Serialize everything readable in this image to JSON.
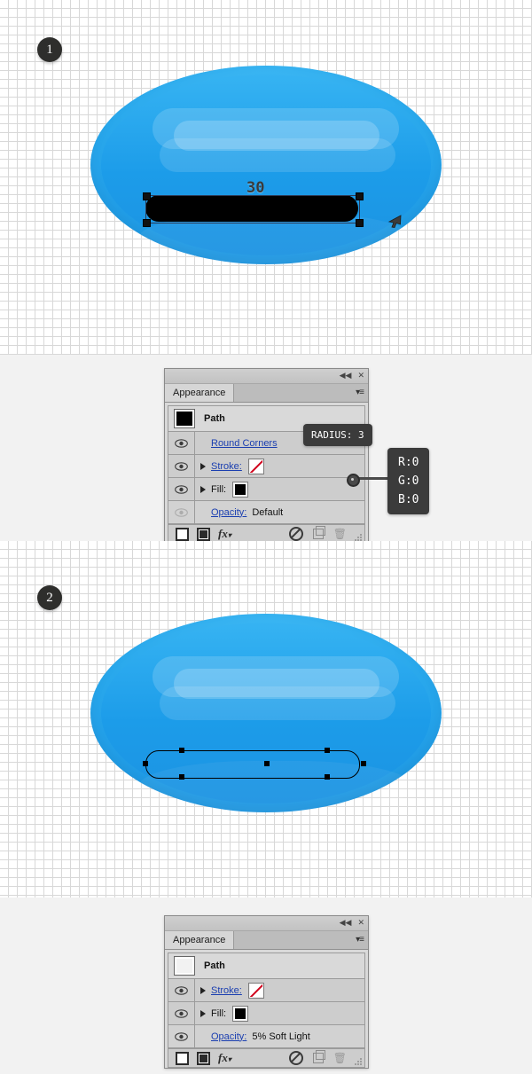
{
  "illustrations": [
    {
      "step_number": "1",
      "label_30": "30",
      "cursor": "arrow-cursor",
      "shape": "blue-ellipse-with-black-rounded-bar"
    },
    {
      "step_number": "2",
      "shape": "blue-ellipse-with-outlined-path"
    }
  ],
  "panel_1": {
    "title": "Appearance",
    "titlebar": {
      "collapse": "◀◀",
      "close": "✕",
      "menu": "▾≡"
    },
    "rows": [
      {
        "type": "header",
        "thumb": "black",
        "label": "Path"
      },
      {
        "type": "item",
        "eye": true,
        "eye_dim": false,
        "arrow": false,
        "label": "Round Corners",
        "link": true
      },
      {
        "type": "item",
        "eye": true,
        "eye_dim": false,
        "arrow": true,
        "label": "Stroke:",
        "link": true,
        "swatch": "none"
      },
      {
        "type": "item",
        "eye": true,
        "eye_dim": false,
        "arrow": true,
        "label": "Fill:",
        "link": false,
        "swatch": "black"
      },
      {
        "type": "item",
        "eye": true,
        "eye_dim": true,
        "arrow": false,
        "label": "Opacity:",
        "link": true,
        "value": "Default"
      }
    ],
    "footer": {
      "new_art_maintains_appearance": "square-outline-icon",
      "clear_appearance": "square-filled-icon",
      "add_effect": "fx-icon",
      "remove_effect": "no-symbol-icon",
      "duplicate_item": "duplicate-icon",
      "delete_item": "trash-icon",
      "resize_grip": "resize-grip-icon"
    }
  },
  "panel_2": {
    "title": "Appearance",
    "titlebar": {
      "collapse": "◀◀",
      "close": "✕",
      "menu": "▾≡"
    },
    "rows": [
      {
        "type": "header",
        "thumb": "white",
        "label": "Path"
      },
      {
        "type": "item",
        "eye": true,
        "eye_dim": false,
        "arrow": true,
        "label": "Stroke:",
        "link": true,
        "swatch": "none"
      },
      {
        "type": "item",
        "eye": true,
        "eye_dim": false,
        "arrow": true,
        "label": "Fill:",
        "link": false,
        "swatch": "black"
      },
      {
        "type": "item",
        "eye": true,
        "eye_dim": false,
        "arrow": false,
        "label": "Opacity:",
        "link": true,
        "value": "5% Soft Light"
      }
    ],
    "footer": {
      "new_art_maintains_appearance": "square-outline-icon",
      "clear_appearance": "square-filled-icon",
      "add_effect": "fx-icon",
      "remove_effect": "no-symbol-icon",
      "duplicate_item": "duplicate-icon",
      "delete_item": "trash-icon",
      "resize_grip": "resize-grip-icon"
    }
  },
  "tooltips": {
    "radius": "RADIUS: 3",
    "rgb": "R:0\nG:0\nB:0"
  },
  "colors": {
    "ellipse_light": "#3fb9f4",
    "ellipse_mid": "#29a8ec",
    "ellipse_dark": "#1f93e0",
    "bar_fill": "#000000",
    "badge_bg": "#2e2e2c",
    "tooltip_bg": "#3b3b3b",
    "link_text": "#1b3fb0",
    "panel_bg": "#d4d4d4",
    "canvas_bg": "#ffffff",
    "grid_line": "#d8d8d8",
    "stroke_none_slash": "#d0021b"
  }
}
